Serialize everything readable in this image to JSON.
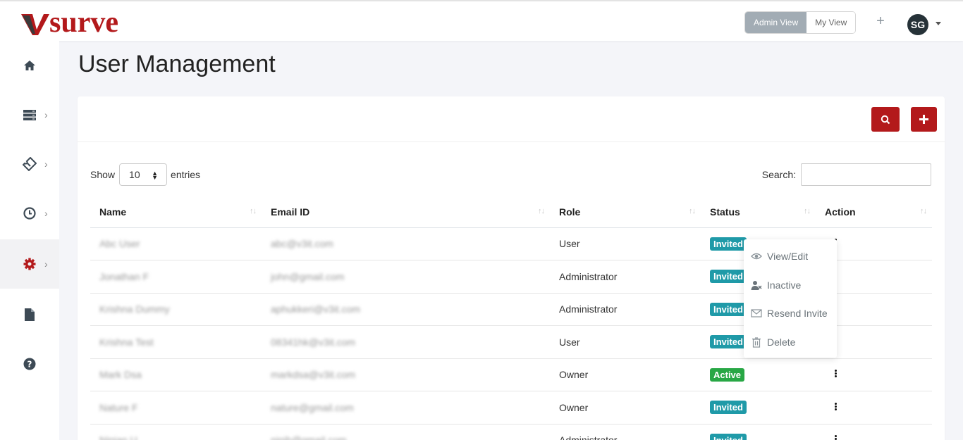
{
  "header": {
    "logo_text": "surve",
    "view_toggle": {
      "admin": "Admin View",
      "my": "My View",
      "active": "admin"
    },
    "add_icon": "plus-icon",
    "avatar_initials": "SG"
  },
  "sidebar": {
    "items": [
      {
        "name": "home",
        "icon": "home-icon"
      },
      {
        "name": "list",
        "icon": "server-list-icon"
      },
      {
        "name": "tickets",
        "icon": "ticket-icon"
      },
      {
        "name": "history",
        "icon": "clock-icon"
      },
      {
        "name": "settings",
        "icon": "gear-icon",
        "active": true
      },
      {
        "name": "documents",
        "icon": "file-icon"
      },
      {
        "name": "help",
        "icon": "question-icon"
      }
    ]
  },
  "page": {
    "title": "User Management"
  },
  "controls": {
    "show_label": "Show",
    "entries_value": "10",
    "entries_label": "entries",
    "search_label": "Search:",
    "search_value": ""
  },
  "table": {
    "columns": [
      "Name",
      "Email ID",
      "Role",
      "Status",
      "Action"
    ],
    "rows": [
      {
        "name": "Abc User",
        "email": "abc@v3it.com",
        "role": "User",
        "status": "Invited"
      },
      {
        "name": "Jonathan F",
        "email": "john@gmail.com",
        "role": "Administrator",
        "status": "Invited"
      },
      {
        "name": "Krishna Dummy",
        "email": "aphukkeri@v3it.com",
        "role": "Administrator",
        "status": "Invited"
      },
      {
        "name": "Krishna Test",
        "email": "08341hk@v3it.com",
        "role": "User",
        "status": "Invited"
      },
      {
        "name": "Mark Dsa",
        "email": "markdsa@v3it.com",
        "role": "Owner",
        "status": "Active"
      },
      {
        "name": "Nature F",
        "email": "nature@gmail.com",
        "role": "Owner",
        "status": "Invited"
      },
      {
        "name": "Ninjan U",
        "email": "ninjh@gmail.com",
        "role": "Administrator",
        "status": "Invited"
      }
    ]
  },
  "action_menu": {
    "items": [
      {
        "label": "View/Edit",
        "icon": "eye-icon"
      },
      {
        "label": "Inactive",
        "icon": "user-remove-icon"
      },
      {
        "label": "Resend Invite",
        "icon": "envelope-icon"
      },
      {
        "label": "Delete",
        "icon": "trash-icon"
      }
    ]
  },
  "colors": {
    "brand_red": "#b3191b",
    "invited_badge": "#1f9aa8",
    "active_badge": "#28a745",
    "toggle_active": "#a2acb4"
  }
}
